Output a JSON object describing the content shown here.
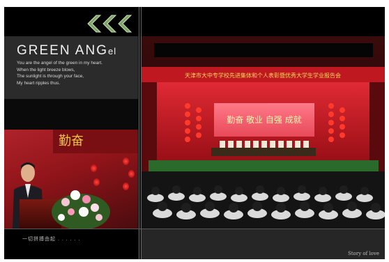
{
  "header": {
    "chevron_count": 3,
    "chevron_color": "#7fa36a"
  },
  "left_panel": {
    "title_main": "GREEN ANG",
    "title_suffix": "el",
    "poem_lines": [
      "You are the angel of the green in my heart.",
      "When the light breeze blows,",
      "The sunlight is through your face,",
      "My heart ripples thus."
    ],
    "photo_banner_text": "勤奋",
    "caption": "一切拼搏由起 . . . . . ."
  },
  "right_panel": {
    "stage_banner_text": "天津市大中专学校先进集体和个人表彰暨优秀大学生学业报告会",
    "screen_text": "勤奋  敬业  自强  成就",
    "caption": "Story of love"
  },
  "colors": {
    "page_bg": "#0a0a0a",
    "panel_gray": "#2b2b2b",
    "stage_red": "#b8141c",
    "accent_green": "#7fa36a"
  }
}
